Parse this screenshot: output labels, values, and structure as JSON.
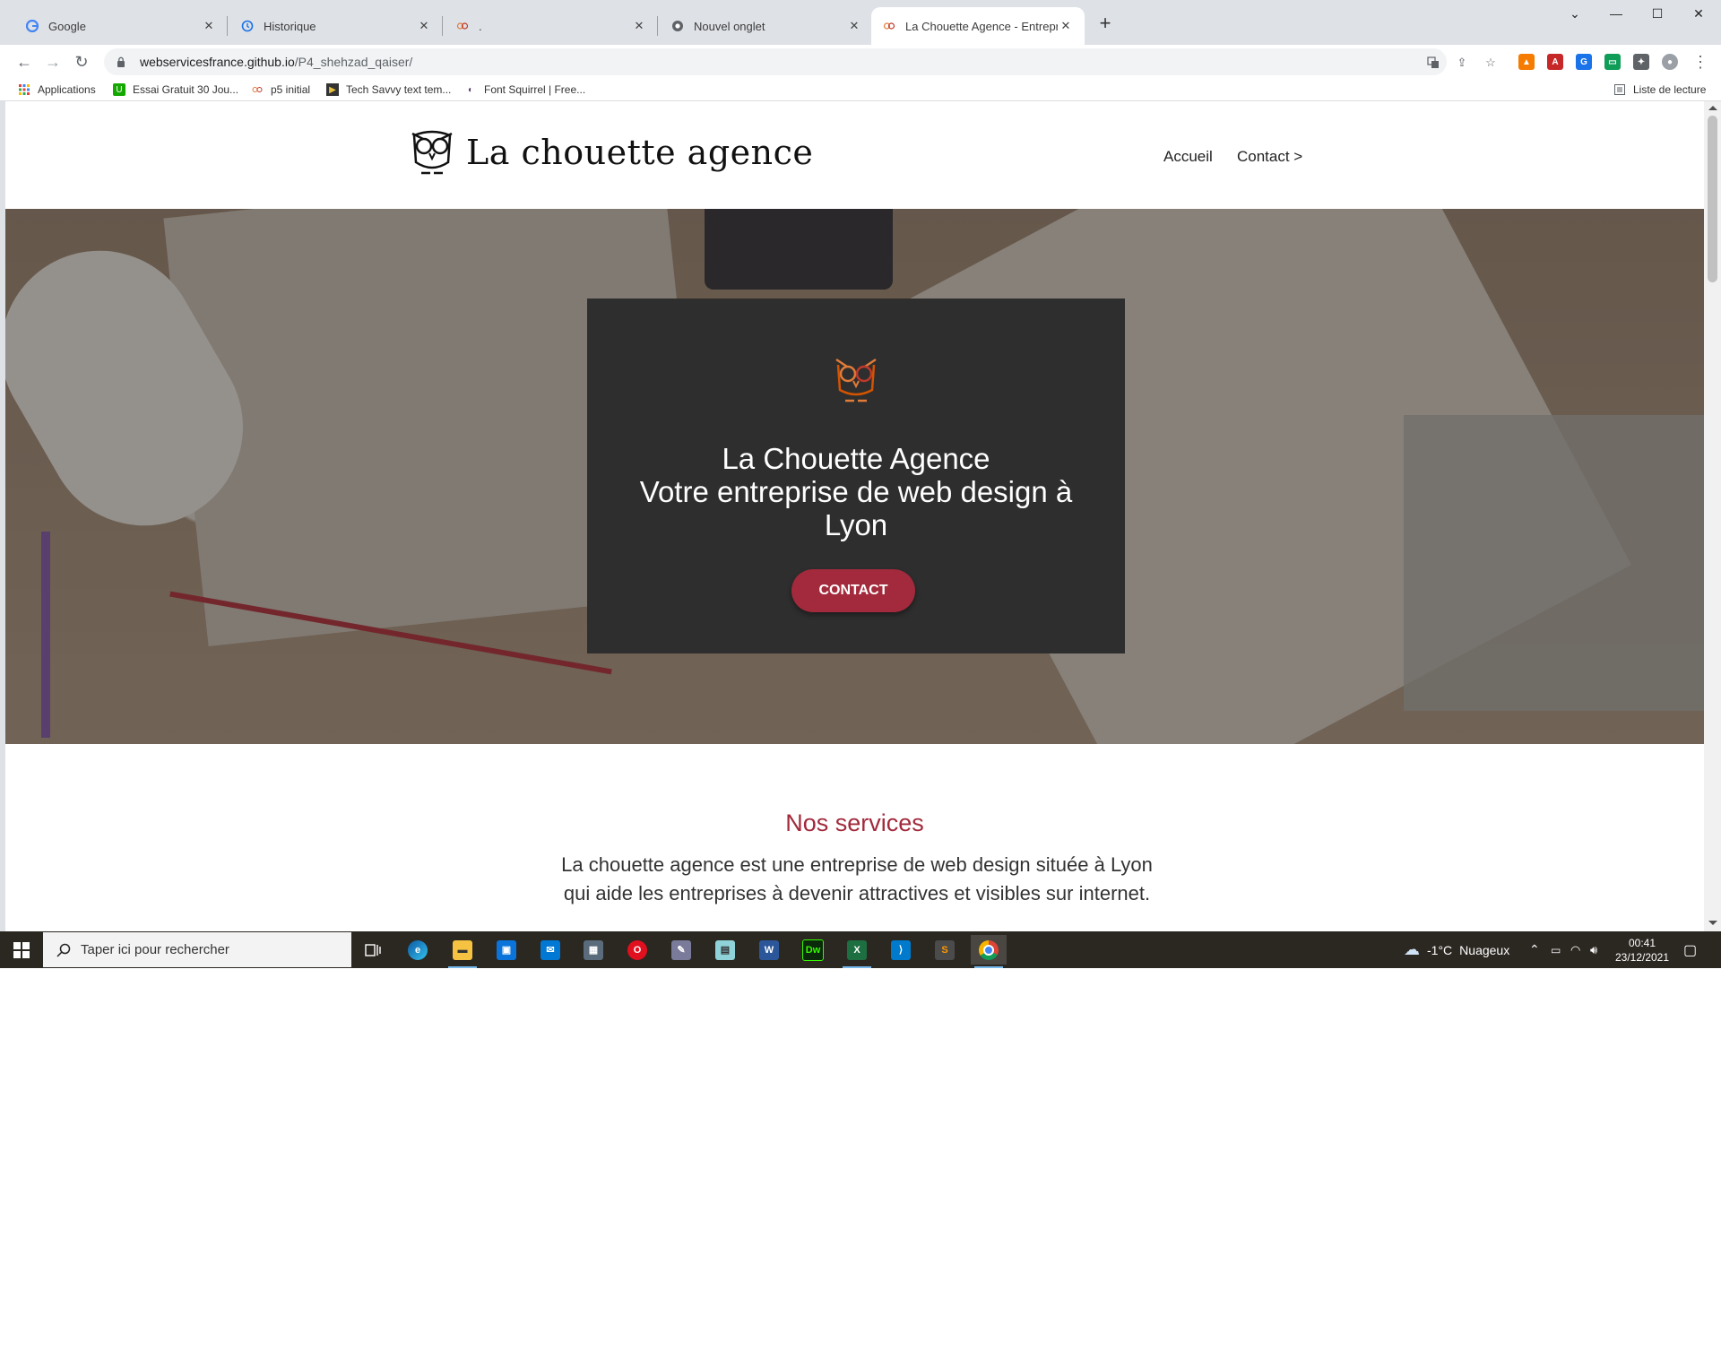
{
  "browser": {
    "tabs": [
      {
        "label": "Google",
        "favicon": "google-icon",
        "active": false
      },
      {
        "label": "Historique",
        "favicon": "history-icon",
        "active": false
      },
      {
        "label": ".",
        "favicon": "owl-favicon",
        "active": false
      },
      {
        "label": "Nouvel onglet",
        "favicon": "chrome-icon",
        "active": false
      },
      {
        "label": "La Chouette Agence - Entreprise",
        "favicon": "owl-favicon",
        "active": true
      }
    ],
    "url": {
      "host": "webservicesfrance.github.io",
      "path": "/P4_shehzad_qaiser/"
    },
    "bookmarks": [
      {
        "label": "Applications",
        "icon": "apps-grid-icon"
      },
      {
        "label": "Essai Gratuit 30 Jou...",
        "icon": "upwork-icon"
      },
      {
        "label": "p5 initial",
        "icon": "owl-favicon"
      },
      {
        "label": "Tech Savvy text tem...",
        "icon": "bookmark-icon"
      },
      {
        "label": "Font Squirrel | Free...",
        "icon": "squirrel-icon"
      }
    ],
    "reading_list": "Liste de lecture"
  },
  "site": {
    "logo_text": "La chouette agence",
    "nav": [
      "Accueil",
      "Contact >"
    ],
    "hero": {
      "line1": "La Chouette Agence",
      "line2": "Votre entreprise de web design à",
      "line3": "Lyon",
      "button": "CONTACT"
    },
    "services": {
      "title": "Nos services",
      "text": "La chouette agence est une entreprise de web design située à Lyon qui aide les entreprises à devenir attractives et visibles sur internet."
    },
    "colors": {
      "accent": "#a22a3c",
      "card": "#2e2e2e"
    }
  },
  "taskbar": {
    "search_placeholder": "Taper ici pour rechercher",
    "apps": [
      "task-view",
      "edge",
      "file-explorer",
      "store",
      "mail",
      "calculator",
      "opera",
      "paint",
      "notes",
      "word",
      "dreamweaver",
      "excel",
      "vscode",
      "sublime",
      "chrome"
    ],
    "weather": {
      "temp": "-1°C",
      "condition": "Nuageux"
    },
    "time": "00:41",
    "date": "23/12/2021"
  }
}
